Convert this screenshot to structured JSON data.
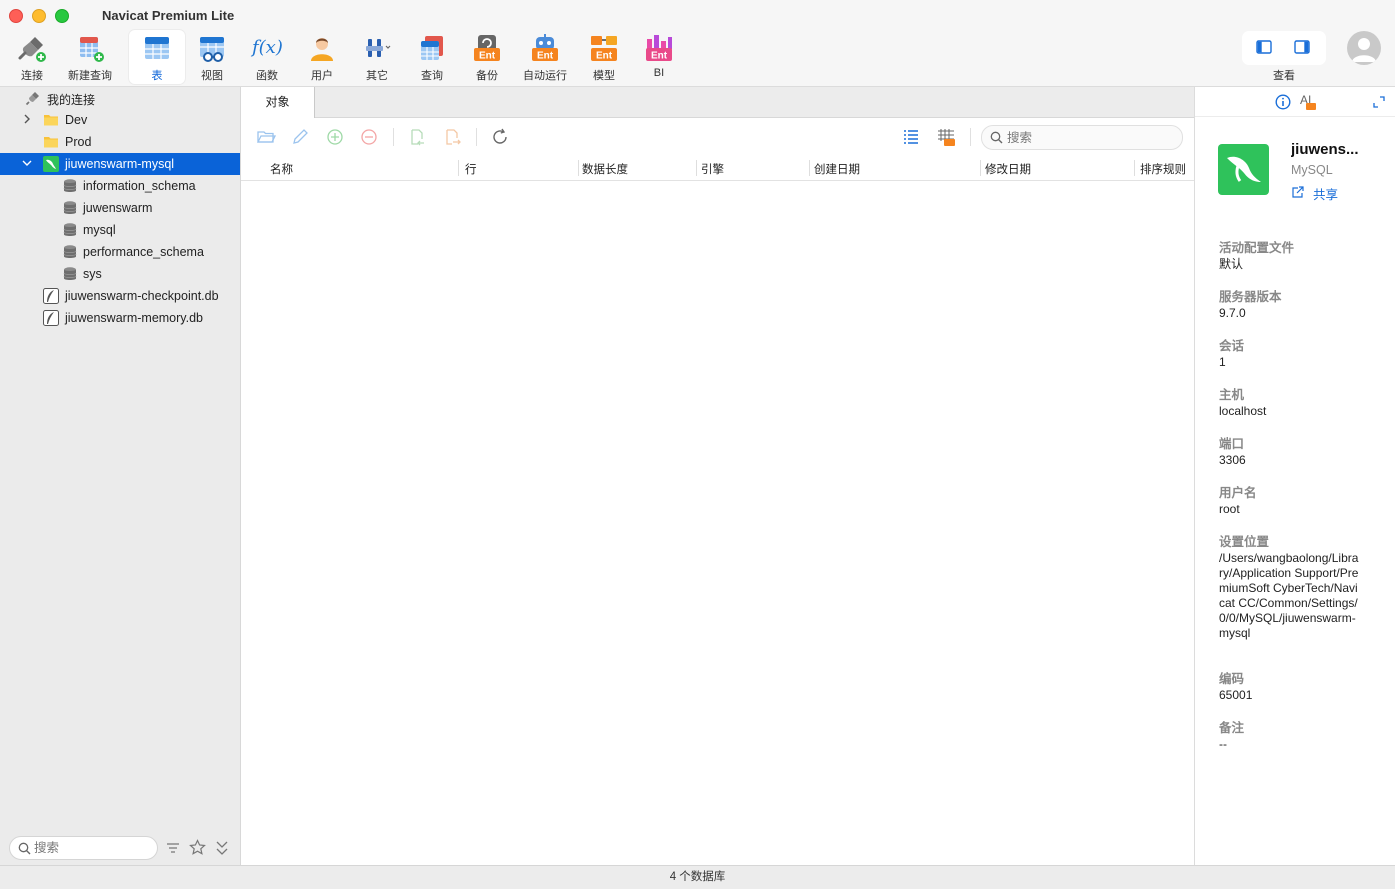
{
  "window": {
    "title": "Navicat Premium Lite"
  },
  "toolbar": {
    "items": [
      {
        "label": "连接",
        "icon": "plug-icon"
      },
      {
        "label": "新建查询",
        "icon": "new-query-icon"
      },
      {
        "label": "表",
        "icon": "table-icon"
      },
      {
        "label": "视图",
        "icon": "view-icon"
      },
      {
        "label": "函数",
        "icon": "function-icon"
      },
      {
        "label": "用户",
        "icon": "user-icon"
      },
      {
        "label": "其它",
        "icon": "tools-icon"
      },
      {
        "label": "查询",
        "icon": "query-icon"
      },
      {
        "label": "备份",
        "icon": "backup-icon"
      },
      {
        "label": "自动运行",
        "icon": "robot-icon"
      },
      {
        "label": "模型",
        "icon": "model-icon"
      },
      {
        "label": "BI",
        "icon": "bi-icon"
      }
    ],
    "ent_badge": "Ent",
    "function_glyph": "f(x)",
    "view_label": "查看"
  },
  "sidebar": {
    "header": "我的连接",
    "items": [
      {
        "label": "Dev"
      },
      {
        "label": "Prod"
      },
      {
        "label": "jiuwenswarm-mysql"
      },
      {
        "label": "information_schema"
      },
      {
        "label": "juwenswarm"
      },
      {
        "label": "mysql"
      },
      {
        "label": "performance_schema"
      },
      {
        "label": "sys"
      },
      {
        "label": "jiuwenswarm-checkpoint.db"
      },
      {
        "label": "jiuwenswarm-memory.db"
      }
    ],
    "search_placeholder": "搜索"
  },
  "main": {
    "tab": "对象",
    "search_placeholder": "搜索",
    "columns": [
      "名称",
      "行",
      "数据长度",
      "引擎",
      "创建日期",
      "修改日期",
      "排序规则"
    ]
  },
  "info": {
    "ai_label": "AI",
    "name": "jiuwens...",
    "type": "MySQL",
    "share": "共享",
    "fields": [
      {
        "label": "活动配置文件",
        "value": "默认"
      },
      {
        "label": "服务器版本",
        "value": "9.7.0"
      },
      {
        "label": "会话",
        "value": "1"
      },
      {
        "label": "主机",
        "value": "localhost"
      },
      {
        "label": "端口",
        "value": "3306"
      },
      {
        "label": "用户名",
        "value": "root"
      },
      {
        "label": "设置位置",
        "value": "/Users/wangbaolong/Library/Application Support/PremiumSoft CyberTech/Navicat CC/Common/Settings/0/0/MySQL/jiuwenswarm-mysql"
      },
      {
        "label": "编码",
        "value": "65001"
      },
      {
        "label": "备注",
        "value": "--"
      }
    ]
  },
  "status": {
    "text": "4 个数据库"
  },
  "colors": {
    "accent": "#0a63d8",
    "mysql_green": "#2fc25b",
    "ent_orange": "#f5841f"
  }
}
